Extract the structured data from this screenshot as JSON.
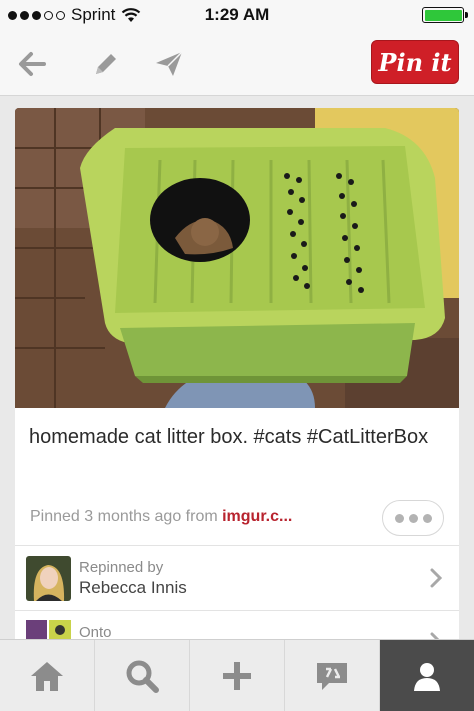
{
  "status_bar": {
    "carrier": "Sprint",
    "time": "1:29 AM",
    "battery_level": 1.0,
    "battery_color": "#2fc73a"
  },
  "nav": {
    "back_icon": "back-arrow-icon",
    "edit_icon": "pencil-icon",
    "send_icon": "paper-plane-icon",
    "pin_button_label": "Pin it",
    "pin_button_color": "#cf1f27"
  },
  "pin": {
    "description": "homemade cat litter box. #cats #CatLitterBox",
    "pinned_prefix": "Pinned 3 months ago from ",
    "source": "imgur.c...",
    "more_icon": "ellipsis-icon"
  },
  "repin": {
    "label": "Repinned by",
    "name": "Rebecca Innis"
  },
  "onto": {
    "label": "Onto"
  },
  "tab_bar": {
    "tabs": [
      {
        "icon": "home-icon"
      },
      {
        "icon": "search-icon"
      },
      {
        "icon": "plus-icon"
      },
      {
        "icon": "news-icon"
      },
      {
        "icon": "profile-icon"
      }
    ]
  }
}
